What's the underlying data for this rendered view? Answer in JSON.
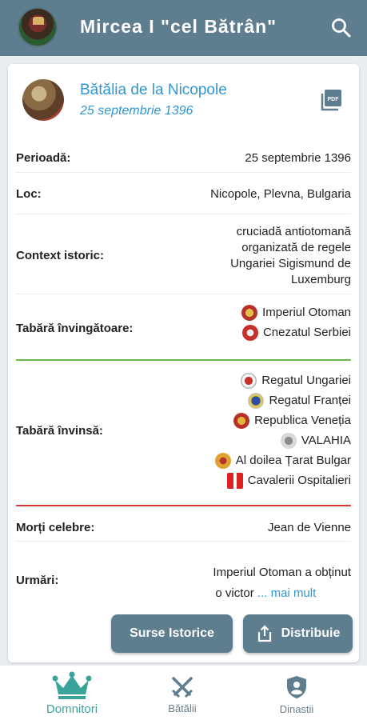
{
  "app": {
    "title": "Mircea I \"cel Bătrân\"",
    "header_color": "#5e7d8f",
    "accent_link": "#2f97d4",
    "icons": {
      "search": "search-icon",
      "pdf": "pdf-icon",
      "avatar": "ruler-portrait"
    }
  },
  "battle": {
    "title": "Bătălia de la Nicopole",
    "date": "25 septembrie 1396"
  },
  "details": {
    "period": {
      "label": "Perioadă:",
      "value": "25 septembrie 1396"
    },
    "location": {
      "label": "Loc:",
      "value": "Nicopole, Plevna, Bulgaria"
    },
    "context": {
      "label": "Context istoric:",
      "lines": [
        "cruciadă antiotomană",
        "organizată de regele",
        "Ungariei Sigismund de",
        "Luxemburg"
      ]
    },
    "winners": {
      "label": "Tabără învingătoare:",
      "teams": [
        "Imperiul Otoman",
        "Cnezatul Serbiei"
      ]
    },
    "losers": {
      "label": "Tabără învinsă:",
      "teams": [
        "Regatul Ungariei",
        "Regatul Franței",
        "Republica Veneția",
        "VALAHIA",
        "Al doilea Țarat Bulgar",
        "Cavalerii Ospitalieri"
      ]
    },
    "famous_deaths": {
      "label": "Morți celebre:",
      "value": "Jean de Vienne"
    },
    "consequences": {
      "label": "Urmări:",
      "line1": "Imperiul Otoman a obținut",
      "line2": "o victor",
      "more": " ... mai mult"
    },
    "separator_colors": {
      "winners": "#6cbb4a",
      "losers": "#d83a3a"
    }
  },
  "actions": {
    "sources": "Surse Istorice",
    "share": "Distribuie"
  },
  "nav": {
    "items": [
      {
        "label": "Domnitori",
        "icon": "crown-icon",
        "active": true
      },
      {
        "label": "Bătălii",
        "icon": "crossed-swords-icon",
        "active": false
      },
      {
        "label": "Dinastii",
        "icon": "shield-icon",
        "active": false
      }
    ],
    "active_color": "#3aa39a"
  }
}
